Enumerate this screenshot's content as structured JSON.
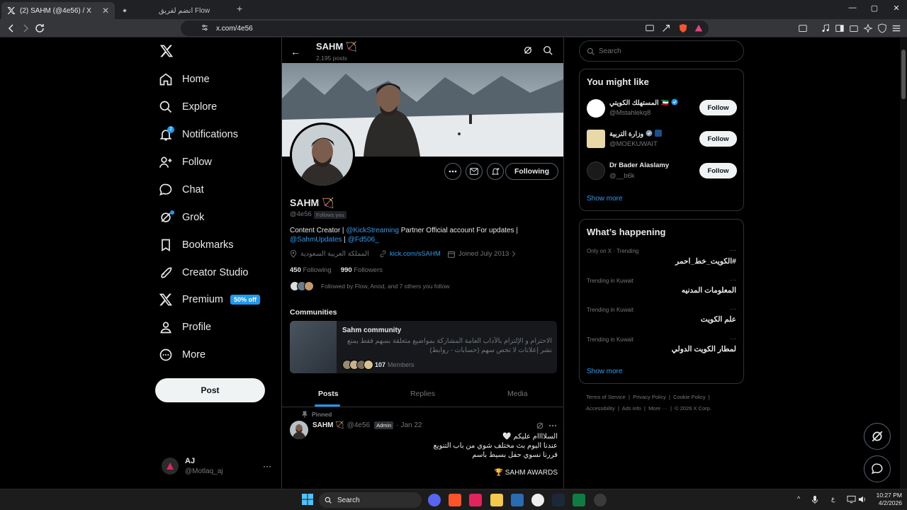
{
  "browser": {
    "tab_active_title": "(2) SAHM (@4e56) / X",
    "tab_other_title": "انضم لفريق Flow",
    "new_tab": "+",
    "url": "x.com/4e56",
    "tab_close": "✕",
    "win_min": "—",
    "win_max": "▢",
    "win_close": "✕"
  },
  "nav": {
    "items": [
      {
        "label": "Home",
        "icon": "home-icon"
      },
      {
        "label": "Explore",
        "icon": "search-icon"
      },
      {
        "label": "Notifications",
        "icon": "bell-icon"
      },
      {
        "label": "Follow",
        "icon": "person-add-icon"
      },
      {
        "label": "Chat",
        "icon": "chat-icon"
      },
      {
        "label": "Grok",
        "icon": "grok-icon"
      },
      {
        "label": "Bookmarks",
        "icon": "bookmark-icon"
      },
      {
        "label": "Creator Studio",
        "icon": "rocket-icon"
      },
      {
        "label": "Premium",
        "icon": "x-icon"
      },
      {
        "label": "Profile",
        "icon": "person-icon"
      },
      {
        "label": "More",
        "icon": "more-circle-icon"
      }
    ],
    "notif_count": "2",
    "premium_badge": "50% off",
    "post_button": "Post",
    "me_name": "AJ",
    "me_handle": "@Motlaq_aj",
    "me_more": "···"
  },
  "header": {
    "back": "←",
    "name": "SAHM 🏹",
    "posts": "2,195 posts"
  },
  "profile": {
    "name": "SAHM 🏹",
    "handle": "@4e56",
    "follows_you": "Follows you",
    "following_button": "Following",
    "bio_1": "Content Creator | ",
    "bio_link1": "@KickStreaming",
    "bio_2": " Partner Official account For updates | ",
    "bio_link2": "@SahmUpdates",
    "bio_3": " | ",
    "bio_link3": "@Fd506_",
    "location": "المملكة العربية السعودية",
    "website": "kick.com/sSAHM",
    "joined": "Joined July 2013",
    "following_count": "450",
    "following_label": "Following",
    "followers_count": "990",
    "followers_label": "Followers",
    "followed_by": "Followed by Flow, Anod, and 7 others you follow"
  },
  "community": {
    "section_title": "Communities",
    "name": "Sahm community",
    "description": "الاحترام و الإلتزام بالآداب العامة المشاركة بمواضيع متعلقة بسهم فقط يمنع نشر إعلانات لا تخص سهم (حسابات - روابط)",
    "members_count": "107",
    "members_label": "Members"
  },
  "profile_tabs": [
    "Posts",
    "Replies",
    "Media"
  ],
  "tweet": {
    "pinned_label": "Pinned",
    "name": "SAHM 🏹",
    "handle": "@4e56",
    "admin_badge": "Admin",
    "date": "· Jan 22",
    "line1": "السلاااام عليكم 🤍",
    "line2": "عندنا اليوم بث مختلف شوي من باب التنويع",
    "line3": "قررنا نسوي حفل بسيط باسم",
    "line4": "🏆 SAHM AWARDS"
  },
  "right": {
    "search_placeholder": "Search",
    "you_might_like": "You might like",
    "suggestions": [
      {
        "name": "المستهلك الكويتي 🇰🇼",
        "handle": "@Mstahlekq8",
        "button": "Follow"
      },
      {
        "name": "وزارة التربية",
        "handle": "@MOEKUWAIT",
        "button": "Follow"
      },
      {
        "name": "Dr Bader Alaslamy",
        "handle": "@__b6k",
        "button": "Follow"
      }
    ],
    "show_more": "Show more",
    "whats_happening": "What’s happening",
    "trends": [
      {
        "category": "Only on X · Trending",
        "title": "#الكويت_خط_احمر"
      },
      {
        "category": "Trending in Kuwait",
        "title": "المعلومات المدنيه"
      },
      {
        "category": "Trending in Kuwait",
        "title": "علم الكويت"
      },
      {
        "category": "Trending in Kuwait",
        "title": "لمطار الكويت الدولي"
      }
    ],
    "trend_more": "···",
    "footer_line1": [
      "Terms of Service",
      "Privacy Policy",
      "Cookie Policy"
    ],
    "footer_line2": [
      "Accessibility",
      "Ads info",
      "More ···",
      "© 2026 X Corp."
    ]
  },
  "taskbar": {
    "search": "Search",
    "time": "10:27 PM",
    "date": "4/2/2026",
    "lang": "ع"
  }
}
